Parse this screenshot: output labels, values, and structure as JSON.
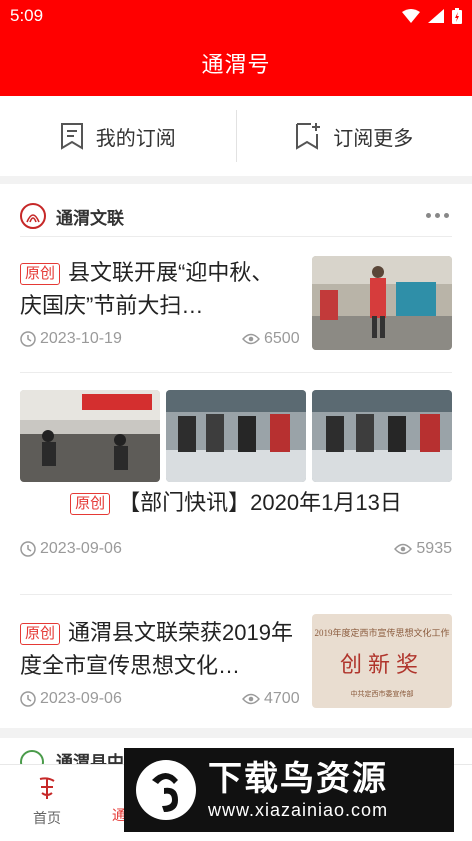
{
  "status_bar": {
    "time": "5:09"
  },
  "header": {
    "title": "通渭号"
  },
  "tabs": [
    {
      "label": "我的订阅",
      "icon": "bookmark-list-icon"
    },
    {
      "label": "订阅更多",
      "icon": "bookmark-add-icon"
    }
  ],
  "channel": {
    "name": "通渭文联",
    "logo": "channel-logo-icon",
    "more_icon": "more-icon"
  },
  "articles": [
    {
      "tag": "原创",
      "title": "县文联开展“迎中秋、庆国庆”节前大扫…",
      "date": "2023-10-19",
      "views": "6500"
    },
    {
      "tag": "原创",
      "title": "【部门快讯】2020年1月13日",
      "date": "2023-09-06",
      "views": "5935"
    },
    {
      "tag": "原创",
      "title": "通渭县文联荣获2019年度全市宣传思想文化…",
      "date": "2023-09-06",
      "views": "4700"
    }
  ],
  "certificate": {
    "heading": "2019年度定西市宣传思想文化工作",
    "award": "创新奖",
    "issuer": "中共定西市委宣传部"
  },
  "next_channel": {
    "name": "通渭县中"
  },
  "bottom_nav": [
    {
      "label": "首页"
    },
    {
      "label": "通"
    }
  ],
  "watermark": {
    "main": "下载鸟资源",
    "url": "www.xiazainiao.com"
  },
  "colors": {
    "brand_red": "#ff0000",
    "tag_red": "#e53935"
  }
}
